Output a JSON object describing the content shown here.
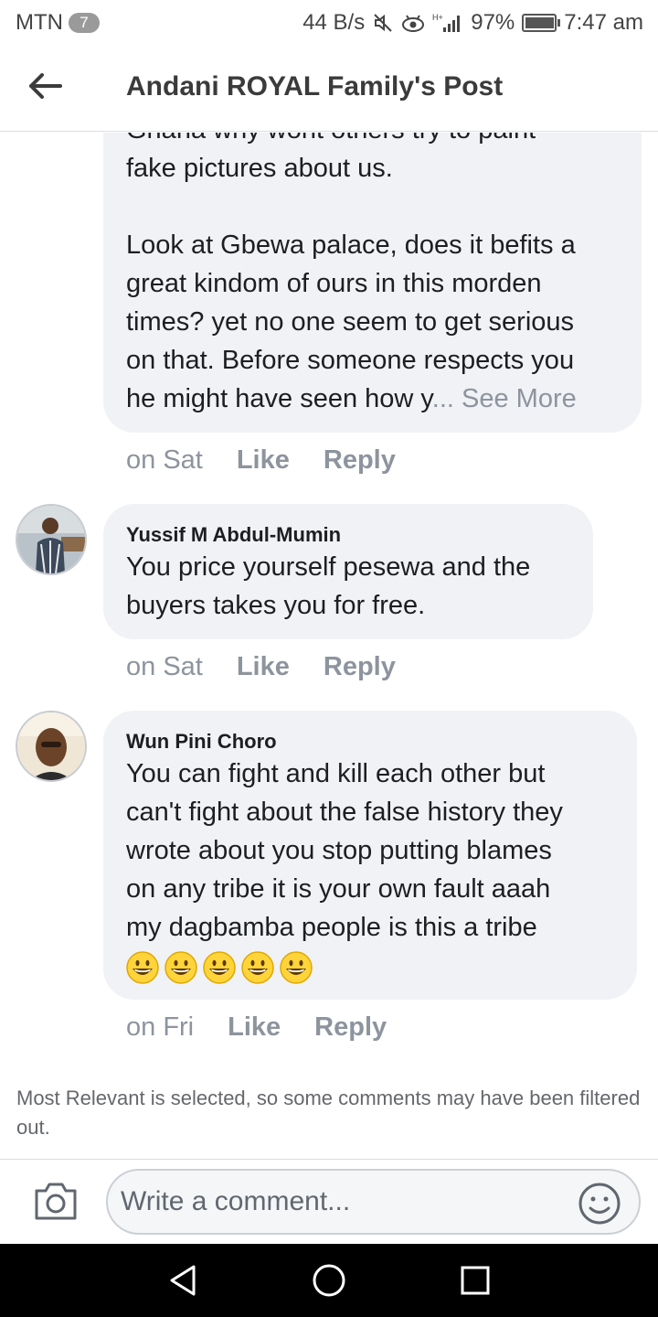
{
  "status_bar": {
    "carrier": "MTN",
    "notification_count": "7",
    "net_speed": "44 B/s",
    "network_type": "H+",
    "battery": "97%",
    "time": "7:47 am",
    "icons": [
      "mute-icon",
      "eye-comfort-icon",
      "signal-icon",
      "battery-icon"
    ]
  },
  "header": {
    "title": "Andani ROYAL Family's Post",
    "back_icon": "back-arrow-icon"
  },
  "comments": [
    {
      "author": "",
      "text_lines": [
        "Ghana why wont others try to paint",
        "fake pictures about us.",
        "",
        "Look at Gbewa palace, does it befits a",
        "great kindom of ours in this morden",
        "times? yet no one seem to get serious",
        "on that. Before someone respects you",
        "he might have seen how y"
      ],
      "ellipsis": "...",
      "see_more": "See More",
      "time": "on Sat",
      "like": "Like",
      "reply": "Reply"
    },
    {
      "author": "Yussif M Abdul-Mumin",
      "text_lines": [
        "You price yourself pesewa and the",
        "buyers takes you for free."
      ],
      "time": "on Sat",
      "like": "Like",
      "reply": "Reply"
    },
    {
      "author": "Wun Pini Choro",
      "text_lines": [
        "You can fight and kill each other but",
        "can't fight about the false history they",
        "wrote about you stop putting blames",
        "on any tribe it is your own fault aaah",
        "my dagbamba people is this a tribe"
      ],
      "emojis": [
        "grinning-face",
        "grinning-face",
        "grinning-face",
        "grinning-face",
        "grinning-face"
      ],
      "time": "on Fri",
      "like": "Like",
      "reply": "Reply"
    }
  ],
  "filter_note": "Most Relevant is selected, so some comments may have been filtered out.",
  "composer": {
    "placeholder": "Write a comment...",
    "camera_icon": "camera-icon",
    "emoji_icon": "smiley-icon"
  },
  "nav_bar": {
    "icons": [
      "back-triangle-icon",
      "home-circle-icon",
      "recents-square-icon"
    ]
  },
  "colors": {
    "bubble_bg": "#f0f2f5",
    "meta_gray": "#8d949e",
    "text": "#1c1e21",
    "nav_bg": "#000000"
  }
}
